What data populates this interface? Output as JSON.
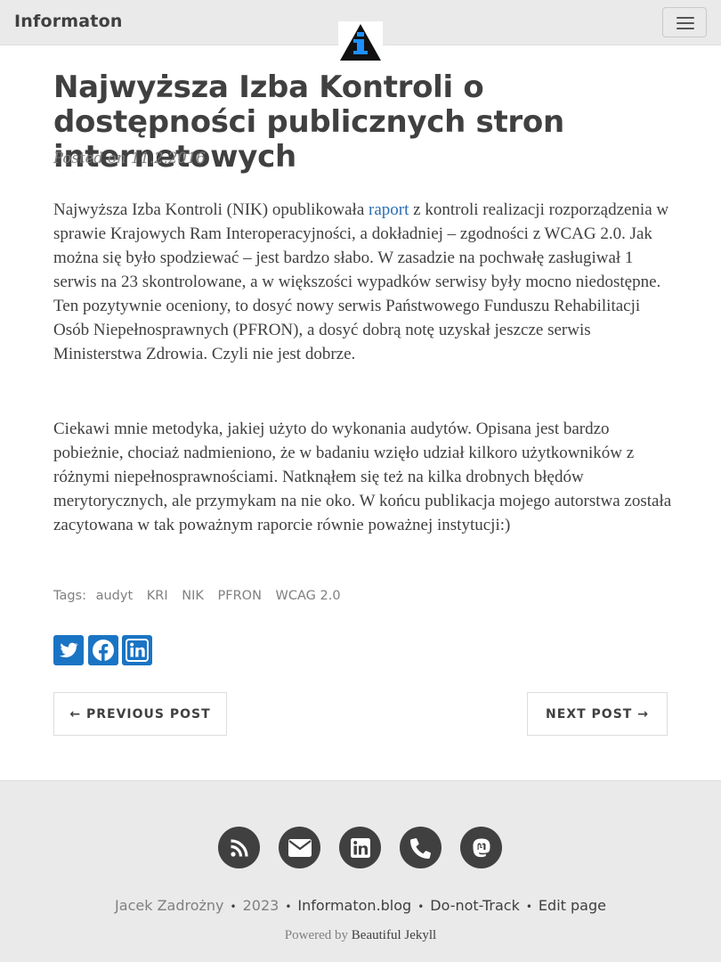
{
  "navbar": {
    "brand": "Informaton",
    "menu_icon": "hamburger-icon",
    "logo_icon": "info-triangle-logo"
  },
  "post": {
    "title": "Najwyższa Izba Kontroli o dostępności publicznych stron internetowych",
    "meta": "Posted on 11.2.2016",
    "p1_before_link": "Najwyższa Izba Kontroli (NIK) opublikowała ",
    "p1_link": "raport",
    "p1_after_link": " z kontroli realizacji rozporządzenia w sprawie Krajowych Ram Interoperacyjności, a dokładniej – zgodności z WCAG 2.0. Jak można się było spodziewać – jest bardzo słabo. W zasadzie na pochwałę zasługiwał 1 serwis na 23 skontrolowane, a w większości wypadków serwisy były mocno niedostępne. Ten pozytywnie oceniony, to dosyć nowy serwis Państwowego Funduszu Rehabilitacji Osób Niepełnosprawnych (PFRON), a dosyć dobrą notę uzyskał jeszcze serwis Ministerstwa Zdrowia. Czyli nie jest dobrze.",
    "p2": "Ciekawi mnie metodyka, jakiej użyto do wykonania audytów. Opisana jest bardzo pobieżnie, chociaż nadmieniono, że w badaniu wzięło udział kilkoro użytkowników z różnymi niepełnosprawnościami. Natknąłem się też na kilka drobnych błędów merytorycznych, ale przymykam na nie oko. W końcu publikacja mojego autorstwa została zacytowana w tak poważnym raporcie równie poważnej instytucji:)",
    "tags_label": "Tags:",
    "tags": [
      "audyt",
      "KRI",
      "NIK",
      "PFRON",
      "WCAG 2.0"
    ],
    "share_icons": [
      "twitter-icon",
      "facebook-icon",
      "linkedin-icon"
    ],
    "share_color": "#1a74c4",
    "prev_label": "← PREVIOUS POST",
    "next_label": "NEXT POST →"
  },
  "footer": {
    "icons": [
      "rss-icon",
      "envelope-icon",
      "linkedin-icon",
      "phone-icon",
      "mastodon-icon"
    ],
    "author": "Jacek Zadrożny",
    "sep": "•",
    "year": "2023",
    "site": "Informaton.blog",
    "dnt": "Do-not-Track",
    "edit": "Edit page",
    "powered_prefix": "Powered by ",
    "powered_link": "Beautiful Jekyll"
  }
}
